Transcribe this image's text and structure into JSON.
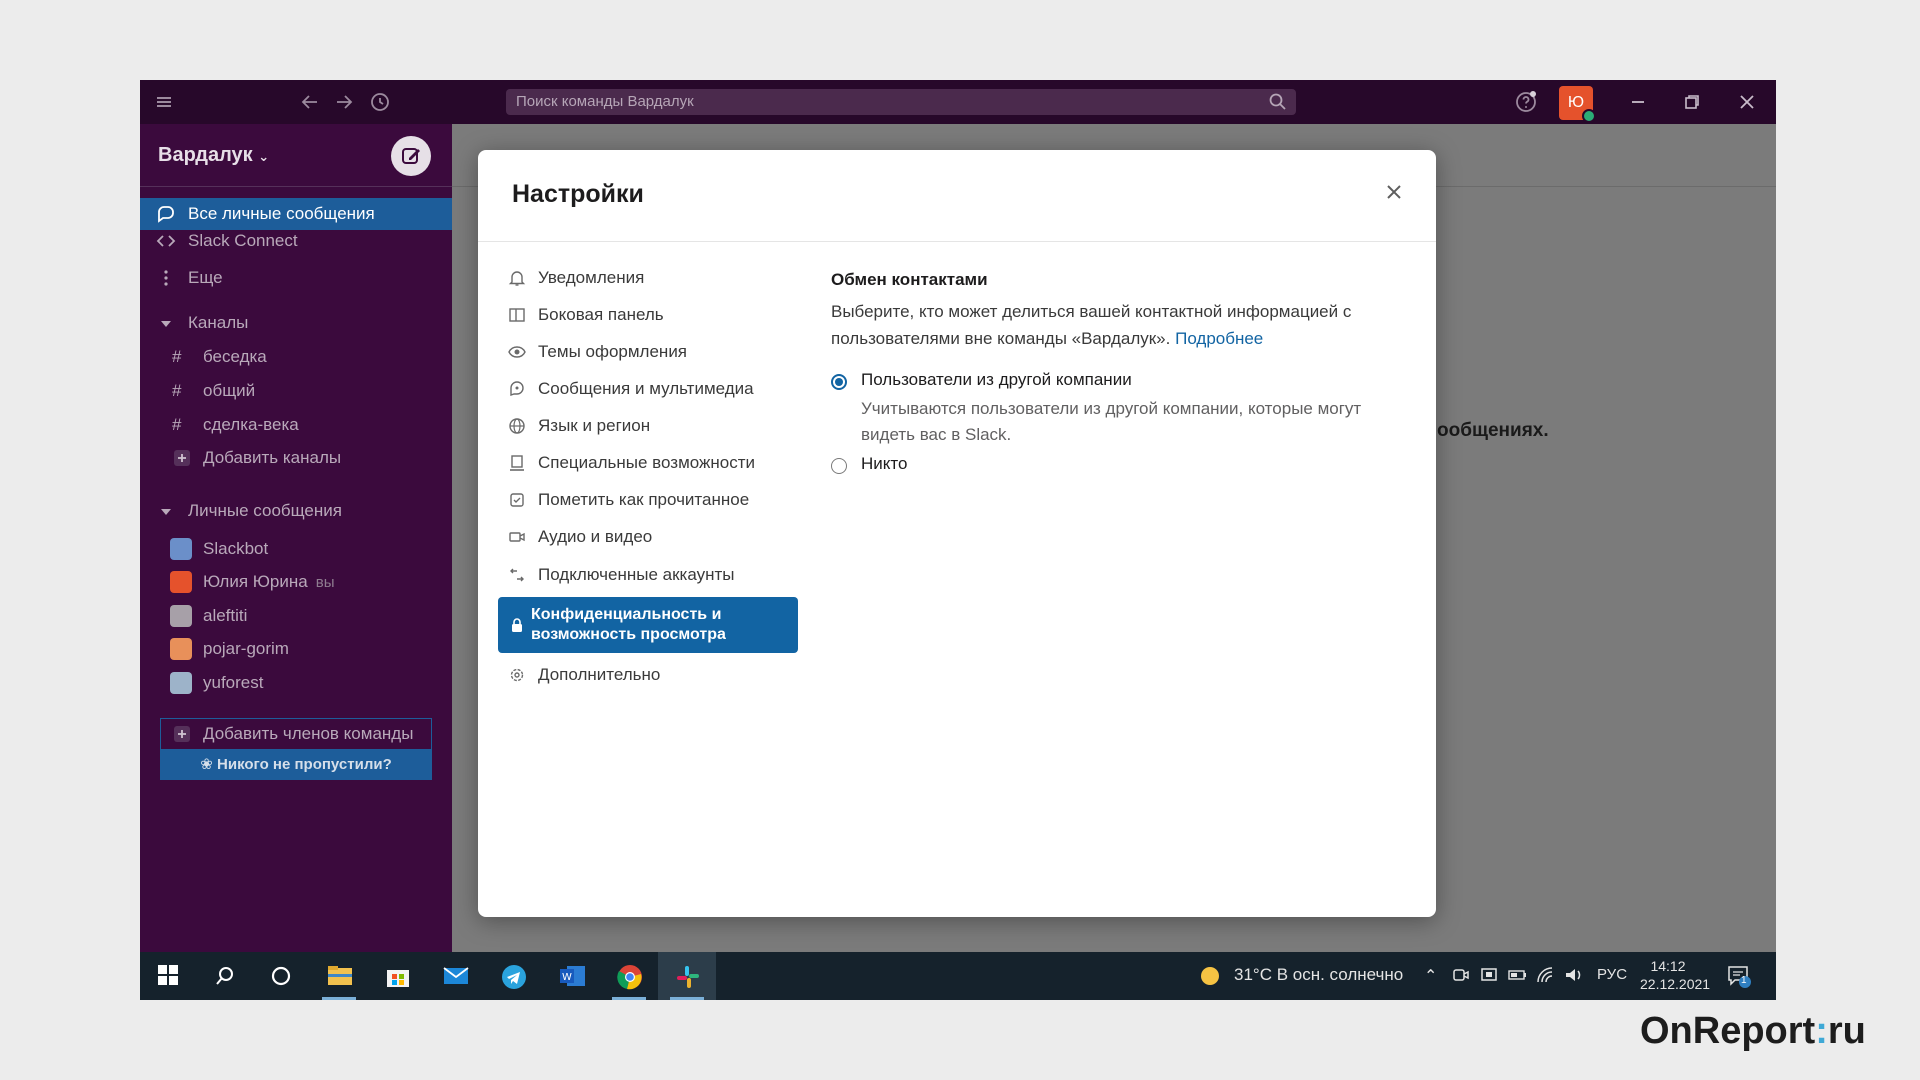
{
  "app": {
    "search_placeholder": "Поиск команды Вардалук",
    "user_avatar_letter": "Ю"
  },
  "sidebar": {
    "workspace_name": "Вардалук",
    "items": [
      {
        "label": "Все личные сообщения",
        "icon": "dm-icon",
        "active": true
      },
      {
        "label": "Slack Connect",
        "icon": "connect-icon"
      },
      {
        "label": "Еще",
        "icon": "more-vertical-icon"
      }
    ],
    "channels_header": "Каналы",
    "channels": [
      "беседка",
      "общий",
      "сделка-века"
    ],
    "add_channels": "Добавить каналы",
    "dms_header": "Личные сообщения",
    "dms": [
      {
        "name": "Slackbot",
        "you": ""
      },
      {
        "name": "Юлия Юрина",
        "you": "вы"
      },
      {
        "name": "aleftiti",
        "you": ""
      },
      {
        "name": "pojar-gorim",
        "you": ""
      },
      {
        "name": "yuforest",
        "you": ""
      }
    ],
    "add_members": "Добавить членов команды",
    "nobody_missed": "Никого не пропустили?"
  },
  "main": {
    "bg_text": "ообщениях."
  },
  "modal": {
    "title": "Настройки",
    "nav": [
      {
        "label": "Уведомления",
        "icon": "bell-icon"
      },
      {
        "label": "Боковая панель",
        "icon": "sidebar-icon"
      },
      {
        "label": "Темы оформления",
        "icon": "eye-icon"
      },
      {
        "label": "Сообщения и мультимедиа",
        "icon": "message-icon"
      },
      {
        "label": "Язык и регион",
        "icon": "globe-icon"
      },
      {
        "label": "Специальные возможности",
        "icon": "accessibility-icon"
      },
      {
        "label": "Пометить как прочитанное",
        "icon": "check-icon"
      },
      {
        "label": "Аудио и видео",
        "icon": "video-icon"
      },
      {
        "label": "Подключенные аккаунты",
        "icon": "connected-accounts-icon"
      },
      {
        "label": "Конфиденциальность и возможность просмотра",
        "icon": "lock-icon",
        "active": true
      },
      {
        "label": "Дополнительно",
        "icon": "gear-icon"
      }
    ],
    "section_title": "Обмен контактами",
    "section_desc": "Выберите, кто может делиться вашей контактной информацией с пользователями вне команды «Вардалук».",
    "section_link": "Подробнее",
    "options": [
      {
        "label": "Пользователи из другой компании",
        "desc": "Учитываются пользователи из другой компании, которые могут видеть вас в Slack.",
        "selected": true
      },
      {
        "label": "Никто",
        "desc": "",
        "selected": false
      }
    ]
  },
  "taskbar": {
    "weather": "31°C  В осн. солнечно",
    "lang": "РУС",
    "time": "14:12",
    "date": "22.12.2021",
    "notifications_count": "1"
  },
  "watermark": {
    "brand_left": "OnReport",
    "brand_colon": ":",
    "brand_right": "ru"
  },
  "colors": {
    "accent": "#1264a3",
    "sidebar_bg": "#3b0a3d",
    "avatar": "#e5522c"
  }
}
